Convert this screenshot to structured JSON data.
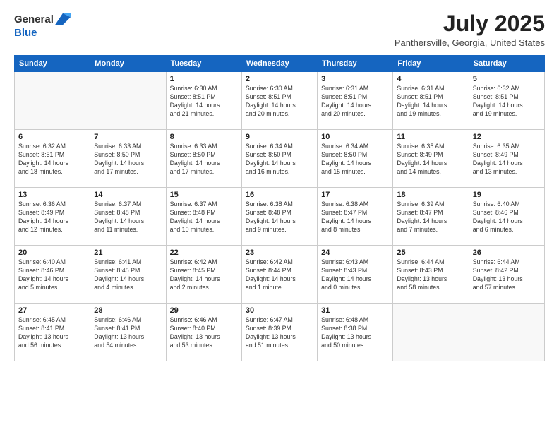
{
  "header": {
    "logo_general": "General",
    "logo_blue": "Blue",
    "title": "July 2025",
    "subtitle": "Panthersville, Georgia, United States"
  },
  "columns": [
    "Sunday",
    "Monday",
    "Tuesday",
    "Wednesday",
    "Thursday",
    "Friday",
    "Saturday"
  ],
  "weeks": [
    [
      {
        "day": "",
        "detail": ""
      },
      {
        "day": "",
        "detail": ""
      },
      {
        "day": "1",
        "detail": "Sunrise: 6:30 AM\nSunset: 8:51 PM\nDaylight: 14 hours\nand 21 minutes."
      },
      {
        "day": "2",
        "detail": "Sunrise: 6:30 AM\nSunset: 8:51 PM\nDaylight: 14 hours\nand 20 minutes."
      },
      {
        "day": "3",
        "detail": "Sunrise: 6:31 AM\nSunset: 8:51 PM\nDaylight: 14 hours\nand 20 minutes."
      },
      {
        "day": "4",
        "detail": "Sunrise: 6:31 AM\nSunset: 8:51 PM\nDaylight: 14 hours\nand 19 minutes."
      },
      {
        "day": "5",
        "detail": "Sunrise: 6:32 AM\nSunset: 8:51 PM\nDaylight: 14 hours\nand 19 minutes."
      }
    ],
    [
      {
        "day": "6",
        "detail": "Sunrise: 6:32 AM\nSunset: 8:51 PM\nDaylight: 14 hours\nand 18 minutes."
      },
      {
        "day": "7",
        "detail": "Sunrise: 6:33 AM\nSunset: 8:50 PM\nDaylight: 14 hours\nand 17 minutes."
      },
      {
        "day": "8",
        "detail": "Sunrise: 6:33 AM\nSunset: 8:50 PM\nDaylight: 14 hours\nand 17 minutes."
      },
      {
        "day": "9",
        "detail": "Sunrise: 6:34 AM\nSunset: 8:50 PM\nDaylight: 14 hours\nand 16 minutes."
      },
      {
        "day": "10",
        "detail": "Sunrise: 6:34 AM\nSunset: 8:50 PM\nDaylight: 14 hours\nand 15 minutes."
      },
      {
        "day": "11",
        "detail": "Sunrise: 6:35 AM\nSunset: 8:49 PM\nDaylight: 14 hours\nand 14 minutes."
      },
      {
        "day": "12",
        "detail": "Sunrise: 6:35 AM\nSunset: 8:49 PM\nDaylight: 14 hours\nand 13 minutes."
      }
    ],
    [
      {
        "day": "13",
        "detail": "Sunrise: 6:36 AM\nSunset: 8:49 PM\nDaylight: 14 hours\nand 12 minutes."
      },
      {
        "day": "14",
        "detail": "Sunrise: 6:37 AM\nSunset: 8:48 PM\nDaylight: 14 hours\nand 11 minutes."
      },
      {
        "day": "15",
        "detail": "Sunrise: 6:37 AM\nSunset: 8:48 PM\nDaylight: 14 hours\nand 10 minutes."
      },
      {
        "day": "16",
        "detail": "Sunrise: 6:38 AM\nSunset: 8:48 PM\nDaylight: 14 hours\nand 9 minutes."
      },
      {
        "day": "17",
        "detail": "Sunrise: 6:38 AM\nSunset: 8:47 PM\nDaylight: 14 hours\nand 8 minutes."
      },
      {
        "day": "18",
        "detail": "Sunrise: 6:39 AM\nSunset: 8:47 PM\nDaylight: 14 hours\nand 7 minutes."
      },
      {
        "day": "19",
        "detail": "Sunrise: 6:40 AM\nSunset: 8:46 PM\nDaylight: 14 hours\nand 6 minutes."
      }
    ],
    [
      {
        "day": "20",
        "detail": "Sunrise: 6:40 AM\nSunset: 8:46 PM\nDaylight: 14 hours\nand 5 minutes."
      },
      {
        "day": "21",
        "detail": "Sunrise: 6:41 AM\nSunset: 8:45 PM\nDaylight: 14 hours\nand 4 minutes."
      },
      {
        "day": "22",
        "detail": "Sunrise: 6:42 AM\nSunset: 8:45 PM\nDaylight: 14 hours\nand 2 minutes."
      },
      {
        "day": "23",
        "detail": "Sunrise: 6:42 AM\nSunset: 8:44 PM\nDaylight: 14 hours\nand 1 minute."
      },
      {
        "day": "24",
        "detail": "Sunrise: 6:43 AM\nSunset: 8:43 PM\nDaylight: 14 hours\nand 0 minutes."
      },
      {
        "day": "25",
        "detail": "Sunrise: 6:44 AM\nSunset: 8:43 PM\nDaylight: 13 hours\nand 58 minutes."
      },
      {
        "day": "26",
        "detail": "Sunrise: 6:44 AM\nSunset: 8:42 PM\nDaylight: 13 hours\nand 57 minutes."
      }
    ],
    [
      {
        "day": "27",
        "detail": "Sunrise: 6:45 AM\nSunset: 8:41 PM\nDaylight: 13 hours\nand 56 minutes."
      },
      {
        "day": "28",
        "detail": "Sunrise: 6:46 AM\nSunset: 8:41 PM\nDaylight: 13 hours\nand 54 minutes."
      },
      {
        "day": "29",
        "detail": "Sunrise: 6:46 AM\nSunset: 8:40 PM\nDaylight: 13 hours\nand 53 minutes."
      },
      {
        "day": "30",
        "detail": "Sunrise: 6:47 AM\nSunset: 8:39 PM\nDaylight: 13 hours\nand 51 minutes."
      },
      {
        "day": "31",
        "detail": "Sunrise: 6:48 AM\nSunset: 8:38 PM\nDaylight: 13 hours\nand 50 minutes."
      },
      {
        "day": "",
        "detail": ""
      },
      {
        "day": "",
        "detail": ""
      }
    ]
  ]
}
